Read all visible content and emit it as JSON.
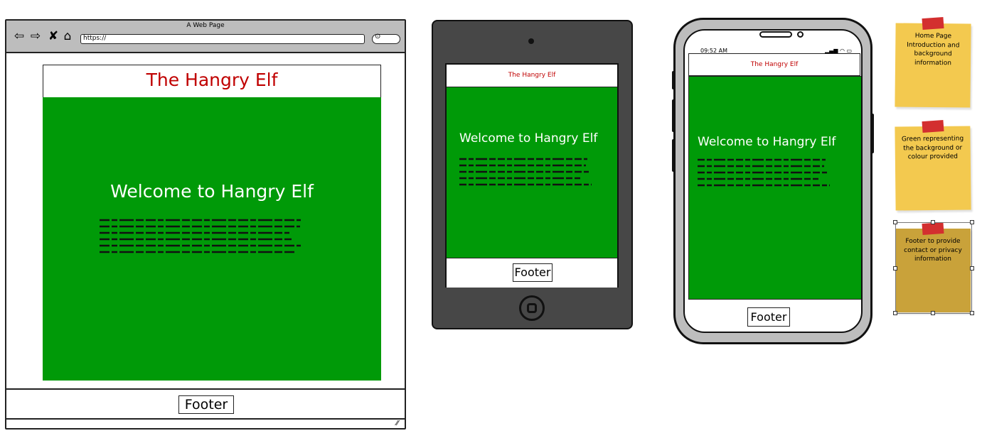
{
  "browser": {
    "window_title": "A Web Page",
    "url": "https://",
    "site_title": "The Hangry Elf",
    "welcome_heading": "Welcome to Hangry Elf",
    "footer_label": "Footer"
  },
  "tablet": {
    "site_title": "The Hangry Elf",
    "welcome_heading": "Welcome to Hangry Elf",
    "footer_label": "Footer"
  },
  "phone": {
    "time": "09:52 AM",
    "site_title": "The Hangry Elf",
    "welcome_heading": "Welcome to Hangry Elf",
    "footer_label": "Footer"
  },
  "notes": [
    {
      "text": "Home Page Introduction and background information"
    },
    {
      "text": "Green representing the background or colour provided"
    },
    {
      "text": "Footer to provide contact or privacy information"
    }
  ],
  "colors": {
    "main_green": "#009a08",
    "title_red": "#c00000",
    "sticky_yellow": "#f3c94f",
    "sticky_selected": "#c9a23a",
    "tablet_body": "#474747",
    "browser_chrome": "#bdbdbd"
  }
}
